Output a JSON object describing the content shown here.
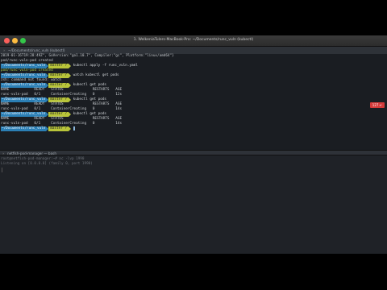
{
  "window": {
    "title": "1. WelkeniaTulers-MacBook-Pro: ~/Documents/runc_vuln (kubectl)"
  },
  "tab": {
    "label": "~/Documents/runc_vuln (kubectl)"
  },
  "prompt": {
    "dir": "~/Documents/runc_vuln",
    "git": "master ?"
  },
  "terminal": {
    "lines": [
      "2019-01-16T19:28:49Z\", GoVersion:\"go1.10.7\", Compiler:\"gc\", Platform:\"linux/amd64\"}",
      "pod/runc-vuln-pod created"
    ],
    "cmd1": "kubectl apply -f runc_vuln.yaml",
    "cmd2": "watch kubectl get pods",
    "zsh_msg": "zsh: command not found: watch",
    "cmd3": "kubectl get pods",
    "cmd4": "kubectl get pods",
    "cmd5": "kubectl get pods",
    "table_header": "NAME            READY   STATUS              RESTARTS   AGE",
    "rows": [
      "runc-vuln-pod   0/1     ContainerCreating   0          12s",
      "runc-vuln-pod   0/1     ContainerCreating   0          14s",
      "runc-vuln-pod   0/1     ContainerCreating   0          14s"
    ]
  },
  "badge": {
    "text": "127 ↵"
  },
  "split_pane": {
    "label": "netfish-pod-manager — bash",
    "lines": [
      "root@netfish-pod-manager:~# nc -lvp 1990",
      "Listening on [0.0.0.0] (family 0, port 1990)"
    ]
  }
}
